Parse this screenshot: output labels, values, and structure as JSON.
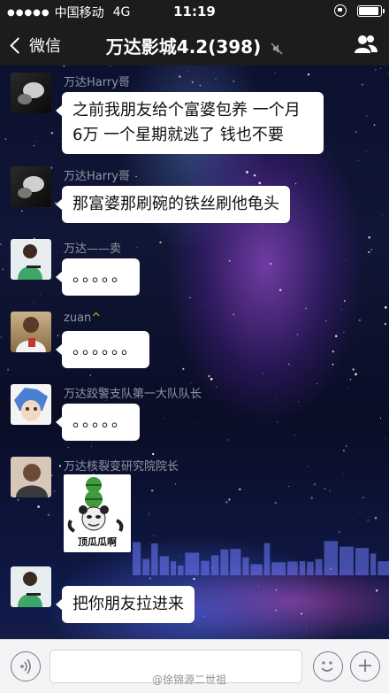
{
  "status_bar": {
    "carrier": "中国移动",
    "network": "4G",
    "time": "11:19"
  },
  "nav": {
    "back_label": "微信",
    "title": "万达影城4.2(398)"
  },
  "messages": [
    {
      "sender": "万达Harry哥",
      "text_lines": [
        "之前我朋友给个富婆包养 一个月",
        "6万 一个星期就逃了 钱也不要"
      ]
    },
    {
      "sender": "万达Harry哥",
      "text_lines": [
        "那富婆那刷碗的铁丝刷他龟头"
      ]
    },
    {
      "sender": "万达——卖",
      "text_lines": [
        "。。。。。"
      ]
    },
    {
      "sender": "zuan",
      "text_lines": [
        "。。。。。。"
      ]
    },
    {
      "sender": "万达跤警支队第一大队队长",
      "text_lines": [
        "。。。。。"
      ]
    },
    {
      "sender": "万达核裂变研究院院长",
      "sticker_caption": "顶瓜瓜啊"
    },
    {
      "sender": "",
      "text_lines": [
        "把你朋友拉进来"
      ]
    }
  ],
  "input_bar": {
    "watermark": "@徐锦源二世祖"
  },
  "colors": {
    "bubble": "#ffffff",
    "bar": "#1c1c1e",
    "input_bar": "#f4f4f6"
  }
}
